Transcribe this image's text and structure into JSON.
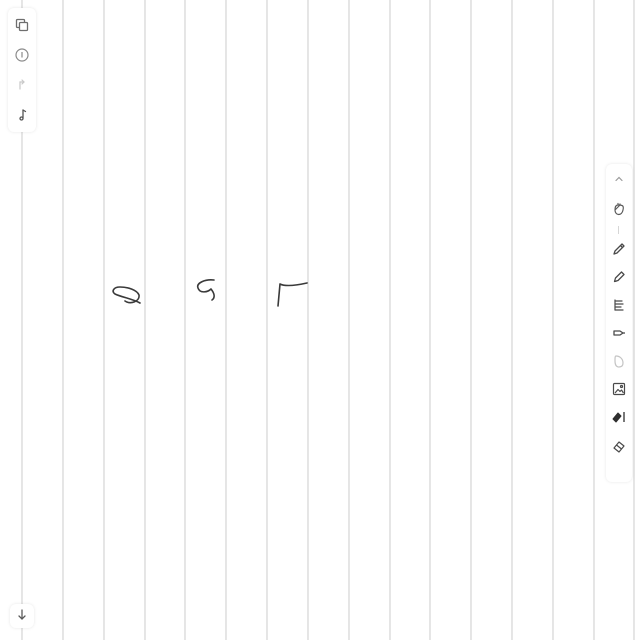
{
  "canvas": {
    "background": "#ffffff",
    "rule_color": "#d4d4d4",
    "ink_color": "#3a3a3a",
    "handwritten_digits": [
      "6",
      "2",
      "7"
    ]
  },
  "left_toolbar": {
    "icons": [
      "copy-icon",
      "info-icon",
      "undo-icon",
      "music-note-icon"
    ]
  },
  "right_toolbar": {
    "icons": [
      "chevron-up-icon",
      "hand-icon",
      "pen-icon",
      "pencil-icon",
      "marker-icon",
      "highlighter-icon",
      "eraser-icon",
      "image-icon",
      "lasso-icon",
      "shape-icon"
    ]
  },
  "bottom_left": {
    "icons": [
      "arrow-down-icon"
    ]
  }
}
